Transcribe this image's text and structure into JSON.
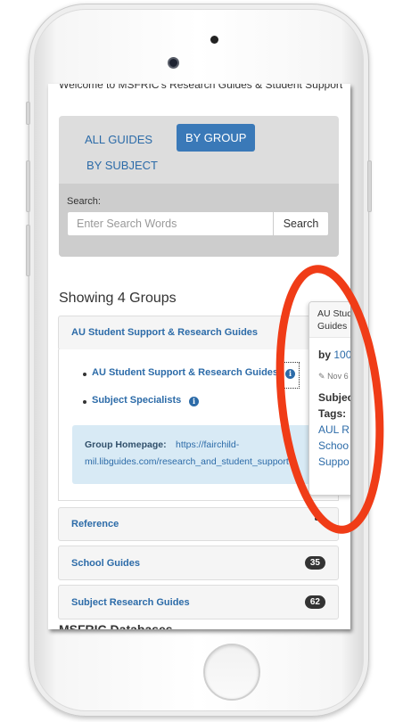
{
  "welcome_text": "Welcome to MSFRIC's Research Guides & Student Support",
  "tabs": {
    "all_guides": "ALL GUIDES",
    "by_group": "BY GROUP",
    "by_subject": "BY SUBJECT"
  },
  "search": {
    "label": "Search:",
    "placeholder": "Enter Search Words",
    "button": "Search"
  },
  "showing": "Showing 4 Groups",
  "groups": [
    {
      "title": "AU Student Support & Research Guides",
      "guides": [
        "AU Student Support & Research Guides",
        "Subject Specialists"
      ],
      "homepage_label": "Group Homepage:",
      "homepage_url_line1": "https://fairchild-",
      "homepage_url_line2": "mil.libguides.com/research_and_student_support"
    },
    {
      "title": "Reference",
      "count": ""
    },
    {
      "title": "School Guides",
      "count": "35"
    },
    {
      "title": "Subject Research Guides",
      "count": "62"
    }
  ],
  "cut_heading": "MSFRIC Databases",
  "popover": {
    "title": "AU Stud\nGuides",
    "by_label": "by",
    "by_value": "100",
    "date": "Nov 6",
    "subjects_label": "Subjec",
    "tags_label": "Tags:",
    "tags_value": "",
    "links": [
      "AUL R",
      "Schoo",
      "Suppo"
    ]
  },
  "colors": {
    "link": "#2c6ba8",
    "active_tab": "#3a79b8",
    "annotation": "#f03c17",
    "badge": "#333333"
  },
  "icons": {
    "info": "info-circle-icon",
    "edit": "pencil-square-icon"
  }
}
